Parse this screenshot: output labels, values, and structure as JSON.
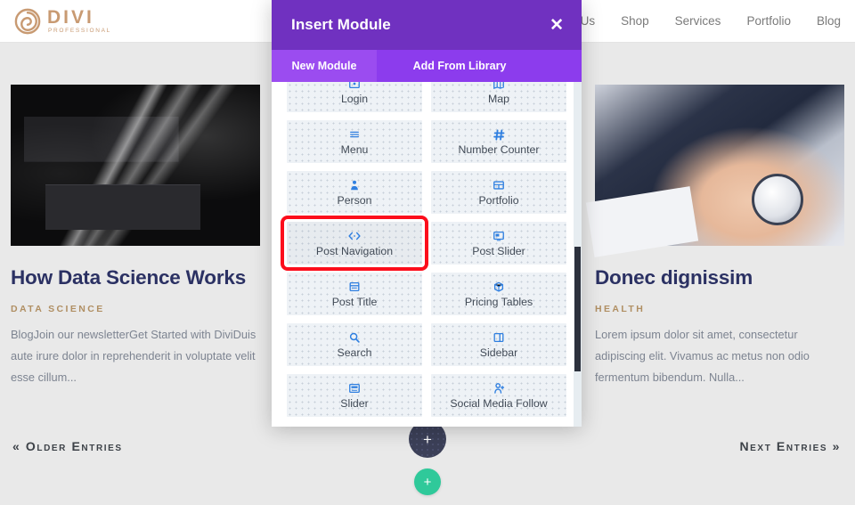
{
  "site": {
    "logo": {
      "name": "DIVI",
      "tagline": "PROFESSIONAL",
      "color": "#c89a72"
    },
    "nav": [
      {
        "label": "About Us"
      },
      {
        "label": "Shop"
      },
      {
        "label": "Services"
      },
      {
        "label": "Portfolio"
      },
      {
        "label": "Blog"
      }
    ]
  },
  "posts": [
    {
      "title": "How Data Science Works",
      "category": "DATA SCIENCE",
      "excerpt": "BlogJoin our newsletterGet Started with DiviDuis aute irure dolor in reprehenderit in voluptate velit esse cillum...",
      "image_alt": "dark server rack with cables"
    },
    {
      "title": "Donec dignissim",
      "category": "HEALTH",
      "excerpt": "Lorem ipsum dolor sit amet, consectetur adipiscing elit. Vivamus ac metus non odio fermentum bibendum. Nulla...",
      "image_alt": "doctor taking blood pressure with cuff"
    }
  ],
  "pagination": {
    "older": "« Older Entries",
    "newer": "Next Entries »"
  },
  "floating": {
    "dark_button_icon": "plus-icon",
    "green_button_icon": "plus-icon",
    "green_color": "#2fc99a",
    "dark_color": "#3c4058"
  },
  "modal": {
    "title": "Insert Module",
    "close_label": "✕",
    "titlebar_color": "#7031c0",
    "tabs": [
      {
        "label": "New Module",
        "active": true
      },
      {
        "label": "Add From Library",
        "active": false
      }
    ],
    "selected_module": "Post Navigation",
    "selection_color": "#fc0d1b",
    "modules": [
      {
        "label": "Login",
        "icon": "login-icon"
      },
      {
        "label": "Map",
        "icon": "map-icon"
      },
      {
        "label": "Menu",
        "icon": "menu-icon"
      },
      {
        "label": "Number Counter",
        "icon": "hash-icon"
      },
      {
        "label": "Person",
        "icon": "person-icon"
      },
      {
        "label": "Portfolio",
        "icon": "grid-icon"
      },
      {
        "label": "Post Navigation",
        "icon": "code-arrows-icon"
      },
      {
        "label": "Post Slider",
        "icon": "post-slider-icon"
      },
      {
        "label": "Post Title",
        "icon": "post-title-icon"
      },
      {
        "label": "Pricing Tables",
        "icon": "pricing-box-icon"
      },
      {
        "label": "Search",
        "icon": "search-icon"
      },
      {
        "label": "Sidebar",
        "icon": "sidebar-icon"
      },
      {
        "label": "Slider",
        "icon": "slider-icon"
      },
      {
        "label": "Social Media Follow",
        "icon": "person-plus-icon"
      }
    ]
  }
}
